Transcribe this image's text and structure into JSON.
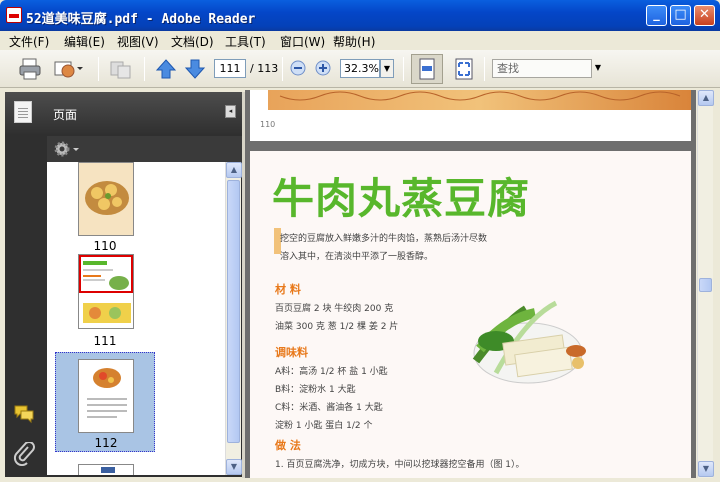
{
  "window": {
    "title": "52道美味豆腐.pdf - Adobe Reader",
    "btn_min": "_",
    "btn_max": "□",
    "btn_close": "✕"
  },
  "menu": [
    "文件(F)",
    "编辑(E)",
    "视图(V)",
    "文档(D)",
    "工具(T)",
    "窗口(W)",
    "帮助(H)"
  ],
  "toolbar": {
    "page_current": "111",
    "page_total": "/ 113",
    "zoom": "32.3%",
    "search_placeholder": "查找"
  },
  "sidebar": {
    "header": "页面",
    "thumbnails": [
      {
        "num": "110"
      },
      {
        "num": "111"
      },
      {
        "num": "112"
      }
    ]
  },
  "page_prev": {
    "number": "110"
  },
  "page": {
    "title": "牛肉丸蒸豆腐",
    "intro": [
      "挖空的豆腐放入鲜嫩多汁的牛肉馅，蒸熟后汤汁尽数",
      "溶入其中，在清淡中平添了一股香醇。"
    ],
    "ingredients_heading": "材 料",
    "ingredients": [
      "百页豆腐 2 块   牛绞肉 200 克",
      "油菜 300 克   葱 1/2 棵   姜 2 片"
    ],
    "seasoning_heading": "调味料",
    "seasoning": [
      "A料：高汤 1/2 杯    盐 1 小匙",
      "B料：淀粉水 1 大匙",
      "C料：米酒、酱油各 1 大匙",
      "        淀粉 1 小匙   蛋白 1/2 个"
    ],
    "method_heading": "做 法",
    "method": [
      "1. 百页豆腐洗净，切成方块，中间以挖球器挖空备用（图 1）。"
    ]
  },
  "colors": {
    "title_green": "#58b72c",
    "heading_orange": "#e8791b",
    "sidebar_dark": "#2f2f2f",
    "selection": "#a9c4e4"
  }
}
